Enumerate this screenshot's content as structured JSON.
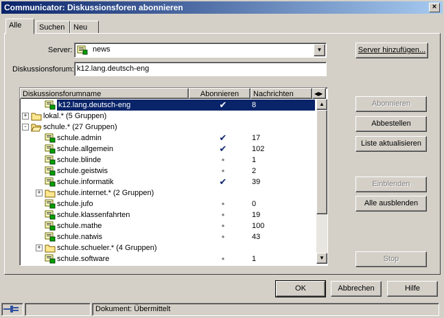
{
  "window": {
    "title": "Communicator: Diskussionsforen abonnieren",
    "close_label": "×"
  },
  "tabs": [
    {
      "label": "Alle"
    },
    {
      "label": "Suchen"
    },
    {
      "label": "Neu"
    }
  ],
  "server": {
    "label": "Server:",
    "value": "news"
  },
  "forum": {
    "label": "Diskussionsforum:",
    "value": "k12.lang.deutsch-eng"
  },
  "list": {
    "columns": [
      "Diskussionsforumname",
      "Abonnieren",
      "Nachrichten"
    ],
    "rows": [
      {
        "name": "k12.lang.deutsch-eng",
        "sub": "check",
        "count": "8",
        "kind": "group",
        "depth": 1,
        "selected": true
      },
      {
        "name": "lokal.* (5 Gruppen)",
        "sub": "",
        "count": "",
        "kind": "folder",
        "depth": 0,
        "expander": "+"
      },
      {
        "name": "schule.* (27 Gruppen)",
        "sub": "",
        "count": "",
        "kind": "folder-open",
        "depth": 0,
        "expander": "-"
      },
      {
        "name": "schule.admin",
        "sub": "check",
        "count": "17",
        "kind": "group",
        "depth": 1
      },
      {
        "name": "schule.allgemein",
        "sub": "check",
        "count": "102",
        "kind": "group",
        "depth": 1
      },
      {
        "name": "schule.blinde",
        "sub": "dot",
        "count": "1",
        "kind": "group",
        "depth": 1
      },
      {
        "name": "schule.geistwis",
        "sub": "dot",
        "count": "2",
        "kind": "group",
        "depth": 1
      },
      {
        "name": "schule.informatik",
        "sub": "check",
        "count": "39",
        "kind": "group",
        "depth": 1
      },
      {
        "name": "schule.internet.* (2 Gruppen)",
        "sub": "",
        "count": "",
        "kind": "folder",
        "depth": 1,
        "expander": "+"
      },
      {
        "name": "schule.jufo",
        "sub": "dot",
        "count": "0",
        "kind": "group",
        "depth": 1
      },
      {
        "name": "schule.klassenfahrten",
        "sub": "dot",
        "count": "19",
        "kind": "group",
        "depth": 1
      },
      {
        "name": "schule.mathe",
        "sub": "dot",
        "count": "100",
        "kind": "group",
        "depth": 1
      },
      {
        "name": "schule.natwis",
        "sub": "dot",
        "count": "43",
        "kind": "group",
        "depth": 1
      },
      {
        "name": "schule.schueler.* (4 Gruppen)",
        "sub": "",
        "count": "",
        "kind": "folder",
        "depth": 1,
        "expander": "+"
      },
      {
        "name": "schule.software",
        "sub": "dot",
        "count": "1",
        "kind": "group",
        "depth": 1
      }
    ]
  },
  "buttons": {
    "add_server": "Server hinzufügen...",
    "subscribe": "Abonnieren",
    "unsubscribe": "Abbestellen",
    "refresh": "Liste aktualisieren",
    "expand": "Einblenden",
    "collapse_all": "Alle ausblenden",
    "stop": "Stop",
    "ok": "OK",
    "cancel": "Abbrechen",
    "help": "Hilfe"
  },
  "status": {
    "text": "Dokument: Übermittelt"
  },
  "colors": {
    "selection": "#0a246a",
    "face": "#d4d0c8",
    "titlebar_start": "#0a246a",
    "titlebar_end": "#a6caf0"
  }
}
